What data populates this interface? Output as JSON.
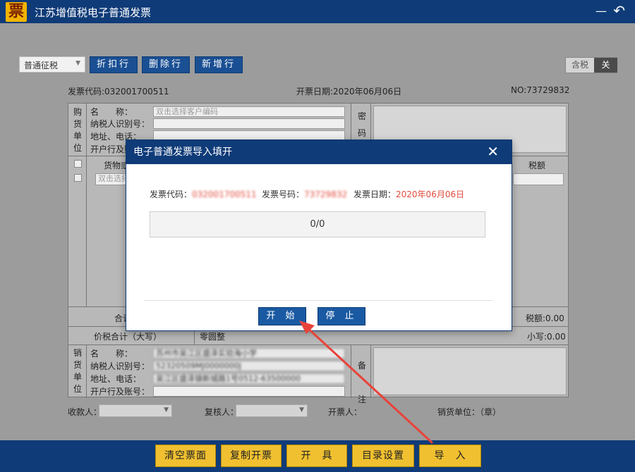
{
  "window": {
    "title": "江苏增值税电子普通发票",
    "logo_char": "票",
    "minimize_glyph": "—",
    "back_glyph": "↶"
  },
  "toolbar": {
    "tax_type": "普通征税",
    "buttons": [
      "折扣行",
      "删除行",
      "新增行"
    ],
    "tax_toggle_on": "含税",
    "tax_toggle_off": "关"
  },
  "invoice_meta": {
    "code_label": "发票代码:032001700511",
    "date_label": "开票日期:2020年06月06日",
    "number_label": "NO:73729832"
  },
  "buyer": {
    "section_label": [
      "购",
      "货",
      "单",
      "位"
    ],
    "name_label": "名　　称：",
    "name_placeholder": "双击选择客户编码",
    "taxid_label": "纳税人识别号：",
    "address_label": "地址、电话：",
    "bank_label": "开户行及账号：",
    "password_label": [
      "密",
      "码"
    ]
  },
  "items": {
    "goods_header": "货物或应税劳务名称",
    "tax_header": "税额",
    "row_placeholder": "双击选择商品",
    "total_label": "合计",
    "tax_total": "税额:0.00",
    "price_tax_label": "价税合计（大写）",
    "capital_amount": "零圆整",
    "small_amount": "小写:0.00"
  },
  "seller": {
    "section_label": [
      "销",
      "货",
      "单",
      "位"
    ],
    "name_label": "名　　称：",
    "name_value": "苏州市吴江区盛泽实验海小学",
    "taxid_label": "纳税人识别号：",
    "taxid_value": "52320509MJ0000000J",
    "address_label": "地址、电话：",
    "address_value": "吴江区盛泽镇新城路1号0512-63500000",
    "bank_label": "开户行及账号：",
    "remark_label": [
      "备",
      "注"
    ]
  },
  "footer": {
    "payee_label": "收款人：",
    "reviewer_label": "复核人：",
    "drawer_label": "开票人：",
    "seller_seal": "销货单位：（章）"
  },
  "bottom_buttons": [
    "清空票面",
    "复制开票",
    "开　具",
    "目录设置",
    "导　入"
  ],
  "dialog": {
    "title": "电子普通发票导入填开",
    "close_glyph": "✕",
    "code_label": "发票代码：",
    "code_value": "032001700511",
    "number_label": "发票号码：",
    "number_value": "73729832",
    "date_label": "发票日期：",
    "date_value": "2020年06月06日",
    "progress_text": "0/0",
    "start_label": "开 始",
    "stop_label": "停 止"
  },
  "progress": {
    "done": 0,
    "total": 0
  },
  "colors": {
    "title_bar": "#0f3b78",
    "accent_button": "#1a4f93",
    "bottom_button": "#f0c030",
    "red_value": "#e14a3b",
    "annotation_arrow": "#e8433a"
  }
}
